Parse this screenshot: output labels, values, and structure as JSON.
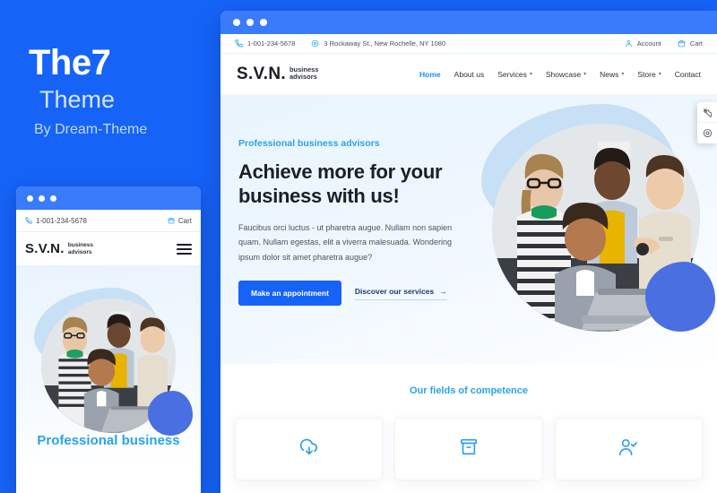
{
  "promo": {
    "title": "The7",
    "subtitle": "Theme",
    "byline": "By Dream-Theme"
  },
  "colors": {
    "brand_blue": "#1663f8",
    "accent_cyan": "#2aa3e8",
    "nav_active": "#1f8ef1",
    "heading_dark": "#1b1f26",
    "blob_light": "#bfdcf3",
    "blob_dark": "#4a6fe0"
  },
  "browser": {
    "dots": [
      "red-dot",
      "yellow-dot",
      "green-dot"
    ],
    "topbar": {
      "phone": "1-001-234-5678",
      "address": "3 Rockaway St., New Rochelle, NY 1080",
      "account_label": "Account",
      "cart_label": "Cart",
      "phone_icon": "phone-icon",
      "location_icon": "location-pin-icon",
      "account_icon": "user-icon",
      "cart_icon": "cart-icon"
    },
    "logo": {
      "main": "S.V.N.",
      "line1": "business",
      "line2": "advisors"
    },
    "menu": [
      {
        "label": "Home",
        "active": true,
        "caret": ""
      },
      {
        "label": "About us",
        "active": false,
        "caret": ""
      },
      {
        "label": "Services",
        "active": false,
        "caret": "▾"
      },
      {
        "label": "Showcase",
        "active": false,
        "caret": "▾"
      },
      {
        "label": "News",
        "active": false,
        "caret": "▾"
      },
      {
        "label": "Store",
        "active": false,
        "caret": "▾"
      },
      {
        "label": "Contact",
        "active": false,
        "caret": ""
      }
    ],
    "hero": {
      "eyebrow": "Professional business advisors",
      "headline": "Achieve more for your business with us!",
      "paragraph": "Faucibus orci luctus - ut pharetra augue. Nullam non sapien quam. Nullam egestas, elit a viverra malesuada. Wondering ipsum dolor sit amet pharetra augue?",
      "primary_button": "Make an appointment",
      "secondary_link": "Discover our services",
      "secondary_arrow": "→",
      "image_alt": "business-team-photo"
    },
    "fields_title": "Our fields of competence",
    "cards": [
      {
        "icon": "cloud-download-icon"
      },
      {
        "icon": "archive-box-icon"
      },
      {
        "icon": "user-check-icon"
      }
    ],
    "sidetool": [
      {
        "icon": "tools-icon"
      },
      {
        "icon": "gear-icon"
      }
    ]
  },
  "mobile": {
    "dots": [
      "red-dot",
      "yellow-dot",
      "green-dot"
    ],
    "topbar": {
      "phone": "1-001-234-5678",
      "cart_label": "Cart",
      "phone_icon": "phone-icon",
      "cart_icon": "cart-icon"
    },
    "logo": {
      "main": "S.V.N.",
      "line1": "business",
      "line2": "advisors"
    },
    "menu_icon": "hamburger-menu-icon",
    "hero_title": "Professional business",
    "image_alt": "business-team-photo"
  }
}
